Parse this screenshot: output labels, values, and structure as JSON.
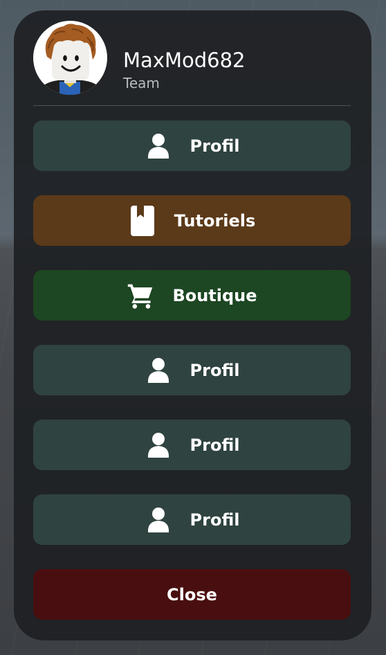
{
  "user": {
    "name": "MaxMod682",
    "role": "Team"
  },
  "menu": {
    "items": [
      {
        "label": "Profil",
        "icon": "user-icon",
        "color": "#2f4340"
      },
      {
        "label": "Tutoriels",
        "icon": "book-icon",
        "color": "#5b3a19"
      },
      {
        "label": "Boutique",
        "icon": "cart-icon",
        "color": "#1d4622"
      },
      {
        "label": "Profil",
        "icon": "user-icon",
        "color": "#2f4340"
      },
      {
        "label": "Profil",
        "icon": "user-icon",
        "color": "#2f4340"
      },
      {
        "label": "Profil",
        "icon": "user-icon",
        "color": "#2f4340"
      }
    ],
    "close_label": "Close",
    "close_color": "#490f10"
  }
}
